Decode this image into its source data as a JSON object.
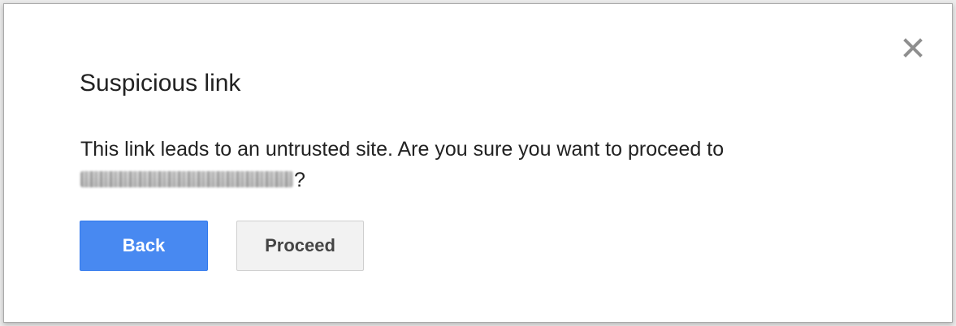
{
  "dialog": {
    "title": "Suspicious link",
    "message": "This link leads to an untrusted site. Are you sure you want to proceed to",
    "message_suffix": "?",
    "close_icon": "close-icon",
    "buttons": {
      "back_label": "Back",
      "proceed_label": "Proceed"
    }
  },
  "colors": {
    "primary_button": "#4889f1",
    "secondary_button": "#f2f2f2",
    "text": "#222222"
  }
}
